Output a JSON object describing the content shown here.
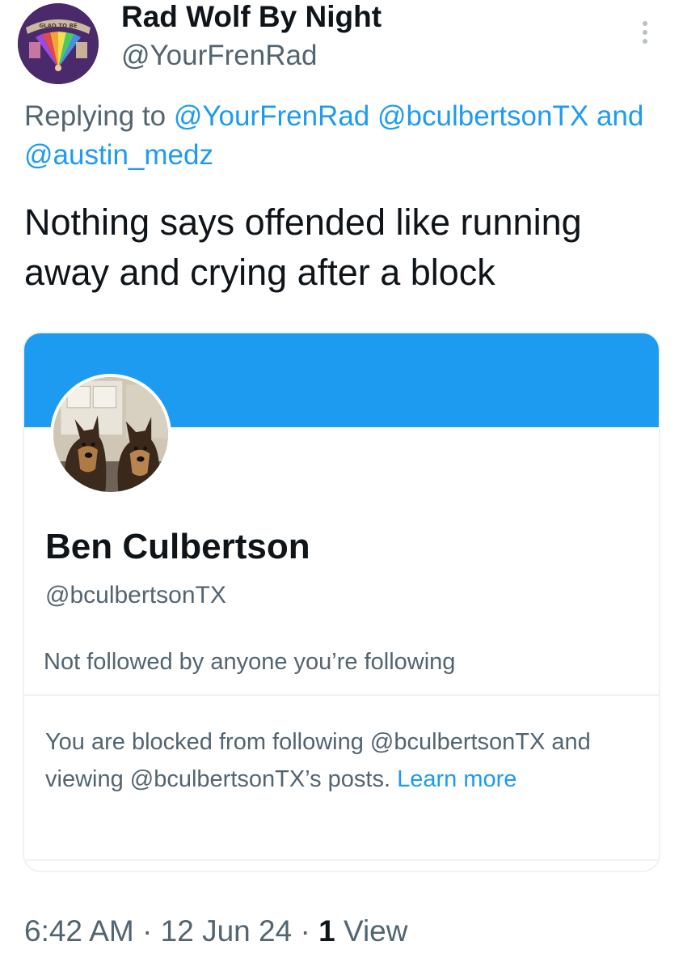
{
  "tweet": {
    "author_name": "Rad Wolf By Night",
    "author_handle": "@YourFrenRad",
    "replying_prefix": "Replying to",
    "replying_mentions": [
      "@YourFrenRad",
      "@bculbertsonTX"
    ],
    "replying_and": "and",
    "replying_last_mention": "@austin_medz",
    "text": "Nothing says offended like running away and crying after a block",
    "time": "6:42 AM",
    "separator": "·",
    "date": "12 Jun 24",
    "view_count": "1",
    "view_label": "View"
  },
  "avatar": {
    "banner_text": "GLAD TO BE"
  },
  "card": {
    "banner_color": "#1d9bf0",
    "name": "Ben Culbertson",
    "handle": "@bculbertsonTX",
    "followed_by": "Not followed by anyone you’re following",
    "blocked_text": "You are blocked from following @bculbertsonTX and viewing @bculbertsonTX’s posts.",
    "learn_more": "Learn more"
  },
  "icons": {
    "more": "more-vertical-icon",
    "avatar": "avatar-image",
    "pfp": "dogs-profile-photo"
  }
}
